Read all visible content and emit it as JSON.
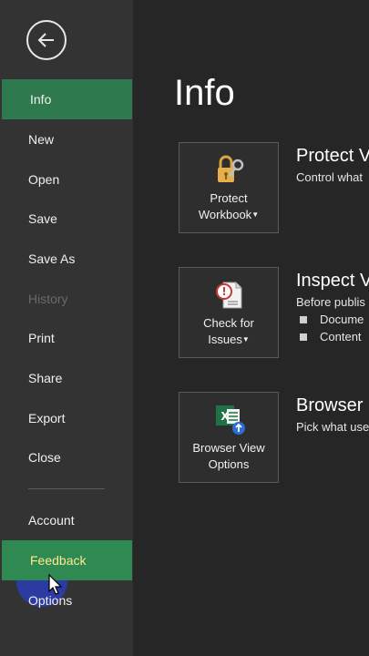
{
  "sidebar": {
    "items": [
      {
        "label": "Info",
        "state": "active"
      },
      {
        "label": "New",
        "state": "normal"
      },
      {
        "label": "Open",
        "state": "normal"
      },
      {
        "label": "Save",
        "state": "normal"
      },
      {
        "label": "Save As",
        "state": "normal"
      },
      {
        "label": "History",
        "state": "disabled"
      },
      {
        "label": "Print",
        "state": "normal"
      },
      {
        "label": "Share",
        "state": "normal"
      },
      {
        "label": "Export",
        "state": "normal"
      },
      {
        "label": "Close",
        "state": "normal"
      },
      {
        "label": "Account",
        "state": "normal"
      },
      {
        "label": "Feedback",
        "state": "hover"
      },
      {
        "label": "Options",
        "state": "normal"
      }
    ]
  },
  "main": {
    "title": "Info",
    "sections": [
      {
        "tile_line1": "Protect",
        "tile_line2": "Workbook",
        "title": "Protect V",
        "desc": "Control what"
      },
      {
        "tile_line1": "Check for",
        "tile_line2": "Issues",
        "title": "Inspect V",
        "desc": "Before publis",
        "bullets": [
          "Docume",
          "Content"
        ]
      },
      {
        "tile_line1": "Browser View",
        "tile_line2": "Options",
        "title": "Browser",
        "desc": "Pick what use"
      }
    ]
  },
  "colors": {
    "accent_green": "#2e7a4e",
    "sidebar_bg": "#333333",
    "main_bg": "#262626"
  },
  "icons": [
    "back-arrow-icon",
    "lock-key-icon",
    "inspect-document-icon",
    "excel-browser-icon"
  ]
}
